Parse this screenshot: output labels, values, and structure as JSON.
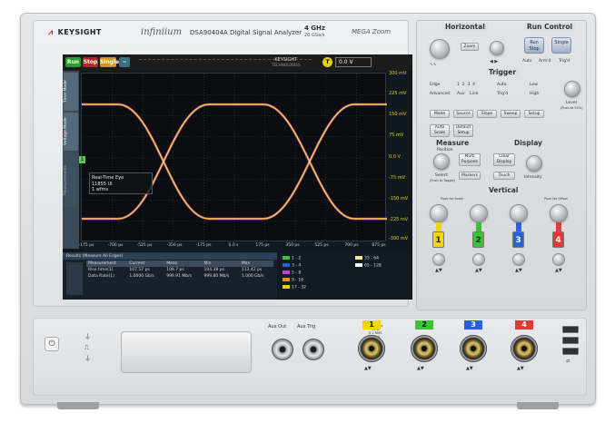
{
  "brand": {
    "name": "KEYSIGHT",
    "sub": "TECHNOLOGIES",
    "series": "infiniium",
    "model": "DSA90404A  Digital Signal Analyzer",
    "spec_bw": "4 GHz",
    "spec_rate": "20 GSa/s",
    "zoom_logo": "MEGA Zoom"
  },
  "screen": {
    "run_label": "Run",
    "stop_label": "Stop",
    "single_label": "Single",
    "trigger_level": "0.0 V",
    "trigger_channel": "T",
    "left_tabs": [
      "Time Mode",
      "Voltage Mode",
      "Measurements"
    ],
    "y_ticks": [
      "300 mV",
      "225 mV",
      "150 mV",
      "75 mV",
      "0.0 V",
      "-75 mV",
      "-150 mV",
      "-225 mV",
      "-300 mV"
    ],
    "x_ticks": [
      "-175 ps",
      "-700 ps",
      "-525 ps",
      "-350 ps",
      "-175 ps",
      "0.0 s",
      "175 ps",
      "350 ps",
      "525 ps",
      "700 ps",
      "875 ps"
    ],
    "info_box": [
      "Real-Time Eye",
      "11855 UI",
      "1 wfms"
    ],
    "results_header": "Results  (Measure All Edges)",
    "results_columns": [
      "Measurement",
      "Current",
      "Mean",
      "Min",
      "Max"
    ],
    "results_rows": [
      [
        "Rise time(1)",
        "107.57 ps",
        "109.7 ps",
        "104.38 ps",
        "113.42 ps"
      ],
      [
        "Data Rate(1)",
        "1.0000 Gb/s",
        "999.91 Mb/s",
        "999.80 Mb/s",
        "1.000 Gb/s"
      ]
    ],
    "legend": [
      {
        "label": "1 - 2",
        "color": "#39c339"
      },
      {
        "label": "3 - 4",
        "color": "#2a62d6"
      },
      {
        "label": "5 - 8",
        "color": "#d13ad1"
      },
      {
        "label": "9 - 16",
        "color": "#e0902a"
      },
      {
        "label": "17 - 32",
        "color": "#e6d100"
      },
      {
        "label": "33 - 64",
        "color": "#f2e98a"
      },
      {
        "label": "65 - 128",
        "color": "#ffffff"
      }
    ]
  },
  "panel": {
    "horizontal": "Horizontal",
    "run_control": "Run Control",
    "trigger": "Trigger",
    "measure": "Measure",
    "display": "Display",
    "vertical": "Vertical",
    "zoom": "Zoom",
    "run_stop": "Run Stop",
    "single": "Single",
    "auto": "Auto",
    "arm": "Arm'd",
    "trigd": "Trig'd",
    "edge": "Edge",
    "advanced": "Advanced",
    "aux": "Aux",
    "line": "Line",
    "auto_trig": "Auto",
    "trig_d": "Trig'd",
    "low": "Low",
    "high": "High",
    "level": "Level",
    "level_sub": "(Push to 50%)",
    "mode": "Mode",
    "source": "Source",
    "slope": "Slope",
    "sweep": "Sweep",
    "setup": "Setup",
    "auto_scale": "Auto Scale",
    "default_setup": "Default Setup",
    "position": "Position",
    "select": "Select",
    "select_sub": "(Push to Toggle)",
    "multi_purpose": "Multi Purpose",
    "markers": "Markers",
    "clear_display": "Clear Display",
    "touch": "Touch",
    "intensity": "Intensity",
    "push_scale": "Push for Scale",
    "push_offset": "Push for Offset",
    "channels": [
      "1",
      "2",
      "3",
      "4"
    ]
  },
  "front": {
    "aux_out": "Aux Out",
    "aux_trig": "Aux Trig",
    "cal_note": [
      "All Inputs",
      "50 Ω",
      "5 V RMS",
      "1 M Ω",
      "300 V",
      "CAT II"
    ],
    "channel_badges": [
      {
        "label": "1",
        "color": "#f2d600"
      },
      {
        "label": "2",
        "color": "#39c339"
      },
      {
        "label": "3",
        "color": "#2a62d6"
      },
      {
        "label": "4",
        "color": "#e03a3a"
      }
    ]
  }
}
